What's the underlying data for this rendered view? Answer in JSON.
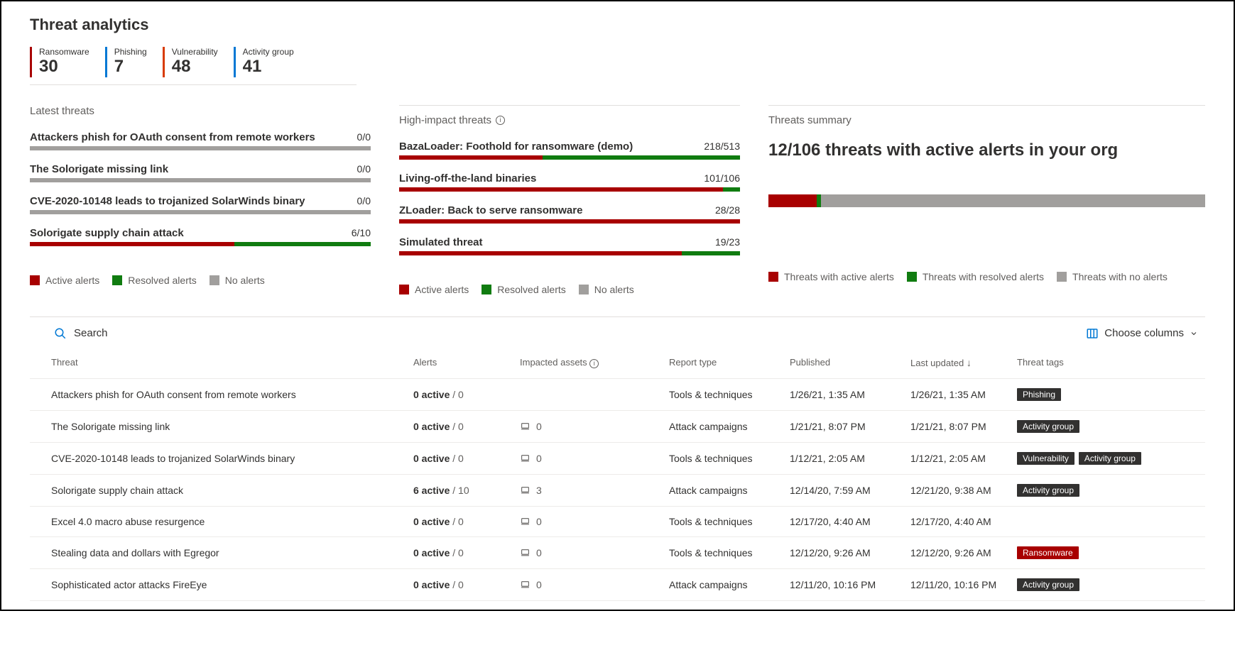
{
  "colors": {
    "red": "#a80000",
    "green": "#107C10",
    "gray": "#a19f9d",
    "blue": "#0078d4",
    "orange": "#d83b01"
  },
  "page_title": "Threat analytics",
  "kpis": [
    {
      "label": "Ransomware",
      "value": "30",
      "color": "#a80000"
    },
    {
      "label": "Phishing",
      "value": "7",
      "color": "#0078d4"
    },
    {
      "label": "Vulnerability",
      "value": "48",
      "color": "#d83b01"
    },
    {
      "label": "Activity group",
      "value": "41",
      "color": "#0078d4"
    }
  ],
  "latest": {
    "title": "Latest threats",
    "items": [
      {
        "name": "Attackers phish for OAuth consent from remote workers",
        "ratio": "0/0",
        "red": 0,
        "green": 0,
        "gray": 100
      },
      {
        "name": "The Solorigate missing link",
        "ratio": "0/0",
        "red": 0,
        "green": 0,
        "gray": 100
      },
      {
        "name": "CVE-2020-10148 leads to trojanized SolarWinds binary",
        "ratio": "0/0",
        "red": 0,
        "green": 0,
        "gray": 100
      },
      {
        "name": "Solorigate supply chain attack",
        "ratio": "6/10",
        "red": 60,
        "green": 40,
        "gray": 0
      }
    ]
  },
  "high_impact": {
    "title": "High-impact threats",
    "items": [
      {
        "name": "BazaLoader: Foothold for ransomware (demo)",
        "ratio": "218/513",
        "red": 42,
        "green": 58,
        "gray": 0
      },
      {
        "name": "Living-off-the-land binaries",
        "ratio": "101/106",
        "red": 95,
        "green": 5,
        "gray": 0
      },
      {
        "name": "ZLoader: Back to serve ransomware",
        "ratio": "28/28",
        "red": 100,
        "green": 0,
        "gray": 0
      },
      {
        "name": "Simulated threat",
        "ratio": "19/23",
        "red": 83,
        "green": 17,
        "gray": 0
      }
    ]
  },
  "legend_small": {
    "active": "Active alerts",
    "resolved": "Resolved alerts",
    "none": "No alerts"
  },
  "summary": {
    "title": "Threats summary",
    "headline": "12/106 threats with active alerts in your org",
    "bar": {
      "red": 11,
      "green": 1,
      "gray": 88
    },
    "legend": {
      "active": "Threats with active alerts",
      "resolved": "Threats with resolved alerts",
      "none": "Threats with no alerts"
    }
  },
  "toolbar": {
    "search_label": "Search",
    "choose_columns": "Choose columns"
  },
  "table": {
    "headers": {
      "threat": "Threat",
      "alerts": "Alerts",
      "assets": "Impacted assets",
      "type": "Report type",
      "published": "Published",
      "updated": "Last updated",
      "tags": "Threat tags"
    },
    "rows": [
      {
        "threat": "Attackers phish for OAuth consent from remote workers",
        "active": 0,
        "total": 0,
        "assets": null,
        "type": "Tools & techniques",
        "published": "1/26/21, 1:35 AM",
        "updated": "1/26/21, 1:35 AM",
        "tags": [
          "Phishing"
        ]
      },
      {
        "threat": "The Solorigate missing link",
        "active": 0,
        "total": 0,
        "assets": 0,
        "type": "Attack campaigns",
        "published": "1/21/21, 8:07 PM",
        "updated": "1/21/21, 8:07 PM",
        "tags": [
          "Activity group"
        ]
      },
      {
        "threat": "CVE-2020-10148 leads to trojanized SolarWinds binary",
        "active": 0,
        "total": 0,
        "assets": 0,
        "type": "Tools & techniques",
        "published": "1/12/21, 2:05 AM",
        "updated": "1/12/21, 2:05 AM",
        "tags": [
          "Vulnerability",
          "Activity group"
        ]
      },
      {
        "threat": "Solorigate supply chain attack",
        "active": 6,
        "total": 10,
        "assets": 3,
        "type": "Attack campaigns",
        "published": "12/14/20, 7:59 AM",
        "updated": "12/21/20, 9:38 AM",
        "tags": [
          "Activity group"
        ]
      },
      {
        "threat": "Excel 4.0 macro abuse resurgence",
        "active": 0,
        "total": 0,
        "assets": 0,
        "type": "Tools & techniques",
        "published": "12/17/20, 4:40 AM",
        "updated": "12/17/20, 4:40 AM",
        "tags": []
      },
      {
        "threat": "Stealing data and dollars with Egregor",
        "active": 0,
        "total": 0,
        "assets": 0,
        "type": "Tools & techniques",
        "published": "12/12/20, 9:26 AM",
        "updated": "12/12/20, 9:26 AM",
        "tags": [
          "Ransomware"
        ]
      },
      {
        "threat": "Sophisticated actor attacks FireEye",
        "active": 0,
        "total": 0,
        "assets": 0,
        "type": "Attack campaigns",
        "published": "12/11/20, 10:16 PM",
        "updated": "12/11/20, 10:16 PM",
        "tags": [
          "Activity group"
        ]
      }
    ]
  }
}
